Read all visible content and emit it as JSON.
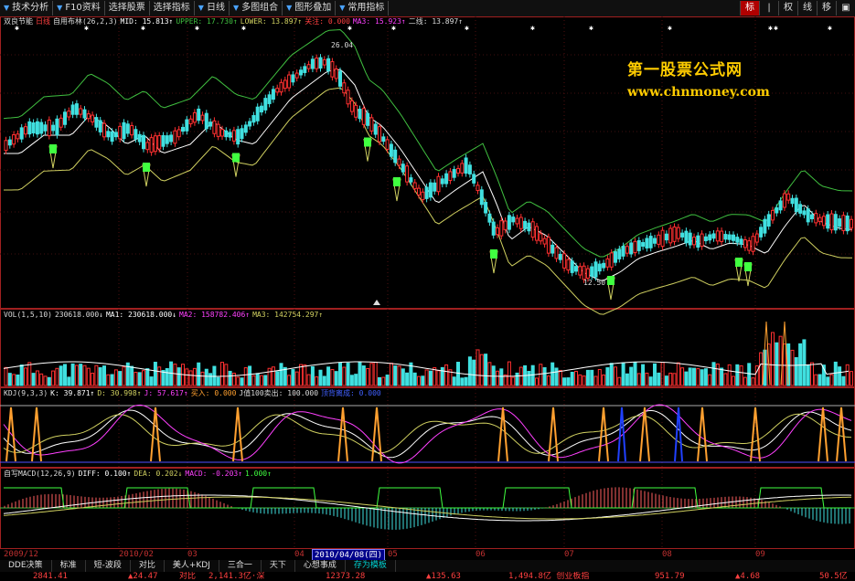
{
  "toolbar": {
    "items": [
      {
        "label": "技术分析",
        "arrow": true
      },
      {
        "label": "F10资料",
        "arrow": true
      },
      {
        "label": "选择股票",
        "arrow": false
      },
      {
        "label": "选择指标",
        "arrow": false
      },
      {
        "label": "日线",
        "arrow": true
      },
      {
        "label": "多图组合",
        "arrow": true
      },
      {
        "label": "图形叠加",
        "arrow": true
      },
      {
        "label": "常用指标",
        "arrow": true
      }
    ],
    "right_buttons": [
      "标",
      "|",
      "权",
      "线",
      "移",
      "▣"
    ]
  },
  "main_panel": {
    "stock_name": "双良节能",
    "period": "日线",
    "indicator": "自用布林(26,2,3)",
    "mid": "MID: 15.813↑",
    "upper": "UPPER: 17.730↑",
    "lower": "LOWER: 13.897↑",
    "guanzhu": "关注: 0.000",
    "ma3": "MA3: 15.923↑",
    "erxian": "二线: 13.897↑",
    "high_label": "26.04",
    "low_label": "12.50"
  },
  "vol_panel": {
    "title": "VOL(1,5,10)",
    "value": "230618.000↓",
    "ma1": "MA1: 230618.000↓",
    "ma2": "MA2: 158782.406↑",
    "ma3": "MA3: 142754.297↑"
  },
  "kdj_panel": {
    "title": "KDJ(9,3,3)",
    "k": "K: 39.871↑",
    "d": "D: 30.998↑",
    "j": "J: 57.617↑",
    "buy": "买入: 0.000",
    "j100": "J值100卖出: 100.000",
    "extra": "顶背离成: 0.000"
  },
  "macd_panel": {
    "title": "自写MACD(12,26,9)",
    "diff": "DIFF: 0.100↑",
    "dea": "DEA: 0.202↓",
    "macd": "MACD: -0.203↑",
    "extra": "1.000↑"
  },
  "watermark": {
    "line1": "第一股票公式网",
    "line2": "www.chnmoney.com"
  },
  "date_axis": {
    "labels": [
      "2009/12",
      "2010/02",
      "03",
      "04",
      "2010/04/08(四)",
      "05",
      "06",
      "07",
      "08",
      "09"
    ],
    "selected": "2010/04/08(四)"
  },
  "tabs": {
    "items": [
      "DDE决策",
      "标准",
      "短-波段",
      "对比",
      "美人+KDJ",
      "三合一",
      "天下",
      "心想事成",
      "存为模板"
    ],
    "active": "存为模板"
  },
  "ticker": {
    "items": [
      "2841.41",
      "▲24.47",
      "对比",
      "2,141.3亿·深",
      "12373.28",
      "▲135.63",
      "1,494.8亿 创业板指",
      "951.79",
      "▲4.68",
      "50.5亿"
    ]
  },
  "colors": {
    "up": "#ff3030",
    "down": "#40e0e0",
    "mid": "#ffffff",
    "upper": "#40c040",
    "lower": "#d0d060",
    "ma3": "#ff40ff",
    "signal": "#40ff40"
  }
}
